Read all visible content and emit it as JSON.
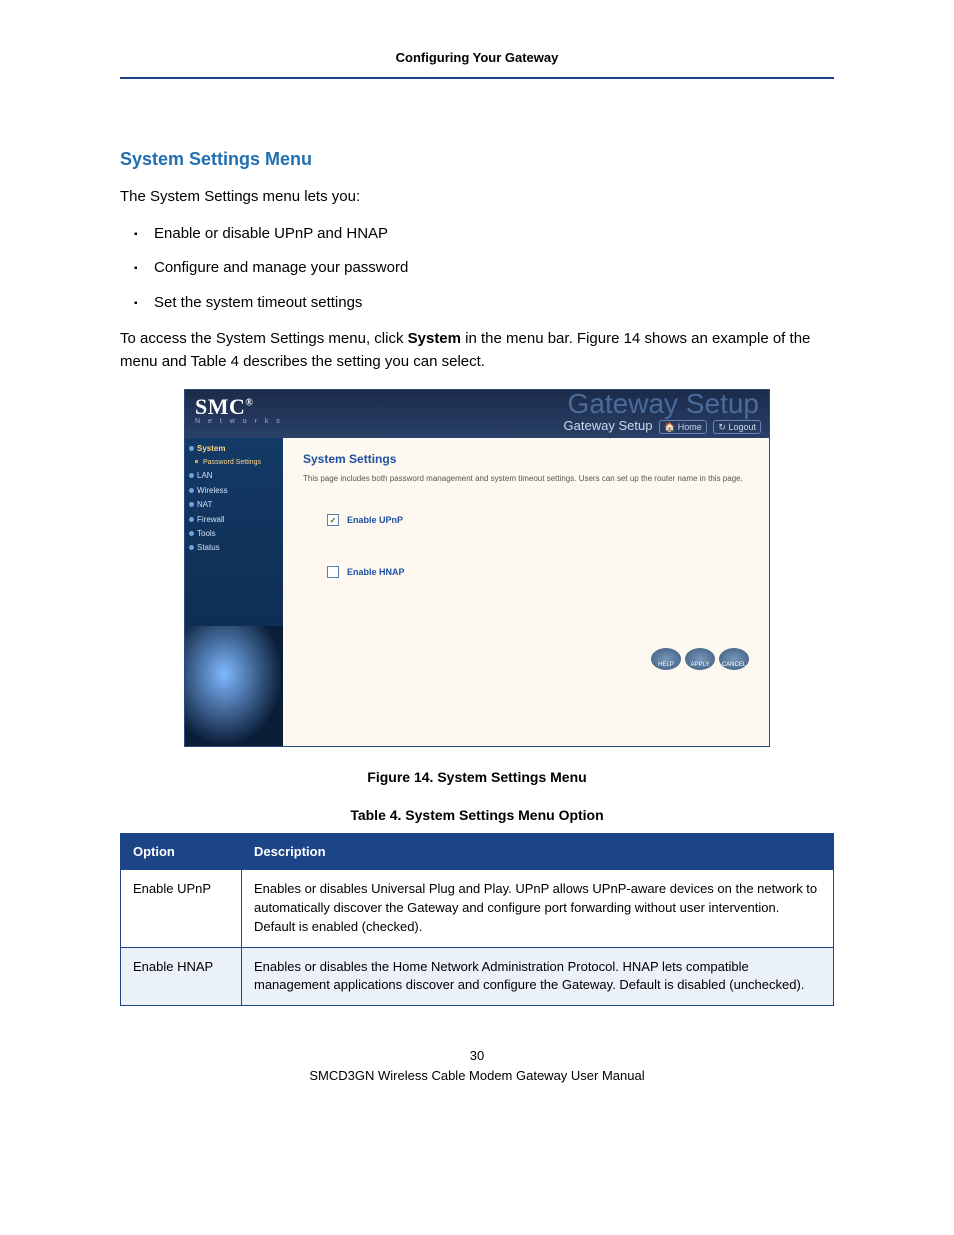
{
  "header": {
    "running": "Configuring Your Gateway"
  },
  "title": "System Settings Menu",
  "intro": "The System Settings menu lets you:",
  "bullets": [
    "Enable or disable UPnP and HNAP",
    "Configure and manage your password",
    "Set the system timeout settings"
  ],
  "access_pre": "To access the System Settings menu, click ",
  "access_bold": "System",
  "access_post": " in the menu bar. Figure 14 shows an example of the menu and Table 4 describes the setting you can select.",
  "figure": {
    "logo": "SMC",
    "logo_sub": "N e t w o r k s",
    "ghost": "Gateway Setup",
    "sub_title": "Gateway Setup",
    "link_home": "Home",
    "link_logout": "Logout",
    "nav": {
      "system": "System",
      "password": "Password Settings",
      "lan": "LAN",
      "wireless": "Wireless",
      "nat": "NAT",
      "firewall": "Firewall",
      "tools": "Tools",
      "status": "Status"
    },
    "panel_title": "System Settings",
    "panel_desc": "This page includes both password management and system timeout settings. Users can set up the router name in this page.",
    "opt_upnp": "Enable UPnP",
    "opt_hnap": "Enable HNAP",
    "btn_help": "HELP",
    "btn_apply": "APPLY",
    "btn_cancel": "CANCEL"
  },
  "caption_fig": "Figure 14. System Settings Menu",
  "caption_tbl": "Table 4. System Settings Menu Option",
  "table": {
    "h1": "Option",
    "h2": "Description",
    "r1": {
      "opt": "Enable UPnP",
      "desc": "Enables or disables Universal Plug and Play. UPnP allows UPnP-aware devices on the network to automatically discover the Gateway and configure port forwarding without user intervention. Default is enabled (checked)."
    },
    "r2": {
      "opt": "Enable HNAP",
      "desc": "Enables or disables the Home Network Administration Protocol. HNAP lets compatible management applications discover and configure the Gateway. Default is disabled (unchecked)."
    }
  },
  "footer": {
    "page": "30",
    "manual": "SMCD3GN Wireless Cable Modem Gateway User Manual"
  }
}
